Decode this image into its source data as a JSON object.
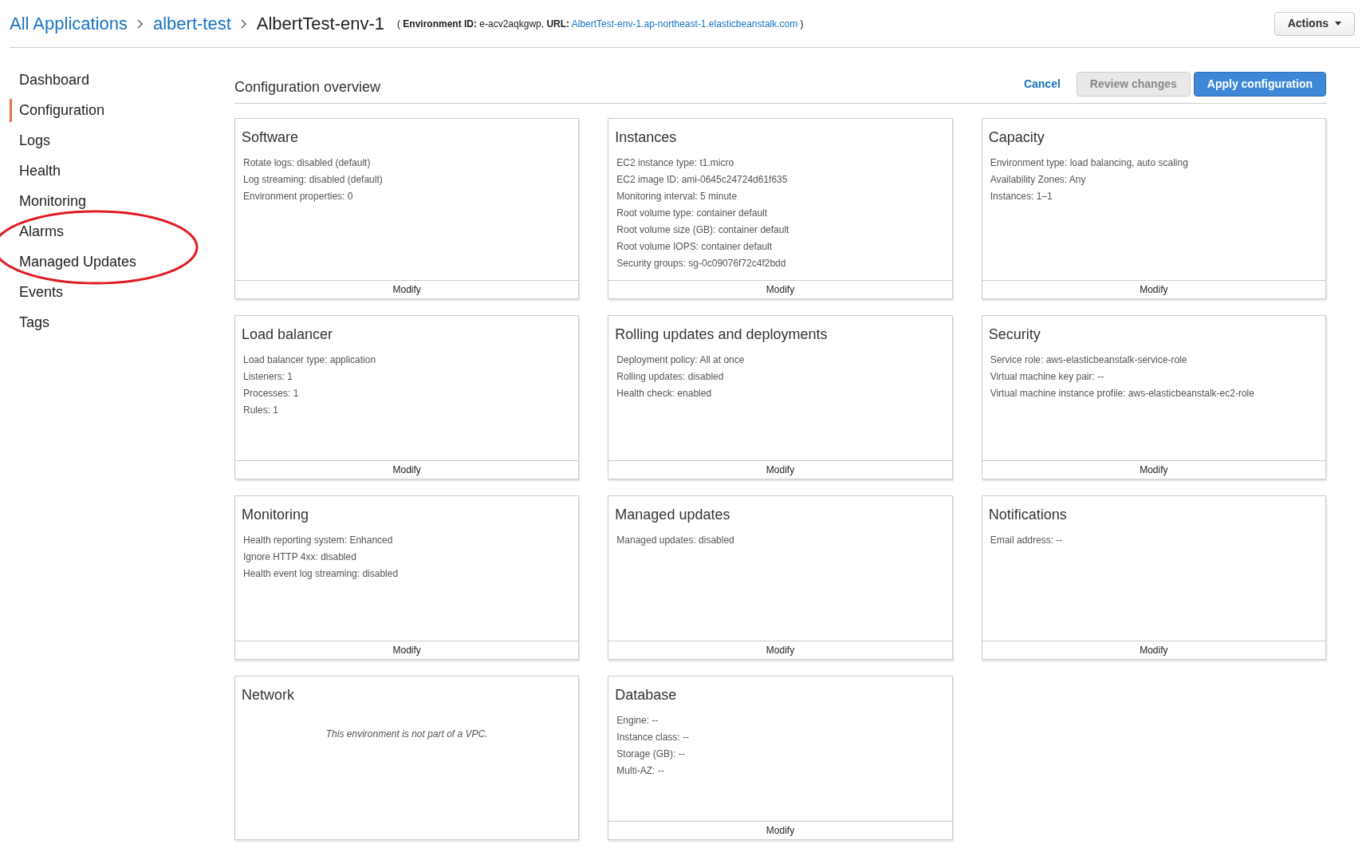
{
  "breadcrumb": [
    {
      "label": "All Applications",
      "kind": "link"
    },
    {
      "label": "albert-test",
      "kind": "link"
    },
    {
      "label": "AlbertTest-env-1",
      "kind": "current"
    }
  ],
  "environment_info": {
    "prefix": "( **Environment ID:** e-acv2aqkgwp, **URL:** ",
    "url": "AlbertTest-env-1.ap-northeast-1.elasticbeanstalk.com",
    "suffix": ")"
  },
  "actions_button": "Actions",
  "sidebar": {
    "items": [
      {
        "label": "Dashboard",
        "selected": false
      },
      {
        "label": "Configuration",
        "selected": true
      },
      {
        "label": "Logs",
        "selected": false
      },
      {
        "label": "Health",
        "selected": false
      },
      {
        "label": "Monitoring",
        "selected": false
      },
      {
        "label": "Alarms",
        "selected": false
      },
      {
        "label": "Managed Updates",
        "selected": false
      },
      {
        "label": "Events",
        "selected": false
      },
      {
        "label": "Tags",
        "selected": false
      }
    ]
  },
  "page_title": "Configuration overview",
  "buttons": [
    {
      "label": "Cancel",
      "kind": "link"
    },
    {
      "label": "Review changes",
      "kind": "disabled"
    },
    {
      "label": "Apply configuration",
      "kind": "primary"
    }
  ],
  "cards": [
    {
      "title": "Software",
      "kind": "list",
      "lines": [
        "Rotate logs: disabled (default)",
        "Log streaming: disabled (default)",
        "Environment properties: 0"
      ],
      "action": "Modify"
    },
    {
      "title": "Instances",
      "kind": "list",
      "lines": [
        "EC2 instance type: t1.micro",
        "EC2 image ID: ami-0645c24724d61f635",
        "Monitoring interval: 5 minute",
        "Root volume type: container default",
        "Root volume size (GB): container default",
        "Root volume IOPS: container default",
        "Security groups: sg-0c09076f72c4f2bdd"
      ],
      "action": "Modify"
    },
    {
      "title": "Capacity",
      "kind": "list",
      "lines": [
        "Environment type: load balancing, auto scaling",
        "Availability Zones: Any",
        "Instances: 1–1"
      ],
      "action": "Modify"
    },
    {
      "title": "Load balancer",
      "kind": "list",
      "lines": [
        "Load balancer type: application",
        "Listeners: 1",
        "Processes: 1",
        "Rules: 1"
      ],
      "action": "Modify"
    },
    {
      "title": "Rolling updates and deployments",
      "kind": "list",
      "lines": [
        "Deployment policy: All at once",
        "Rolling updates: disabled",
        "Health check: enabled"
      ],
      "action": "Modify"
    },
    {
      "title": "Security",
      "kind": "list",
      "lines": [
        "Service role: aws-elasticbeanstalk-service-role",
        "Virtual machine key pair: --",
        "Virtual machine instance profile: aws-elasticbeanstalk-ec2-role"
      ],
      "action": "Modify"
    },
    {
      "title": "Monitoring",
      "kind": "list",
      "lines": [
        "Health reporting system: Enhanced",
        "Ignore HTTP 4xx: disabled",
        "Health event log streaming: disabled"
      ],
      "action": "Modify"
    },
    {
      "title": "Managed updates",
      "kind": "list",
      "lines": [
        "Managed updates: disabled"
      ],
      "action": "Modify"
    },
    {
      "title": "Notifications",
      "kind": "list",
      "lines": [
        "Email address: --"
      ],
      "action": "Modify"
    },
    {
      "title": "Network",
      "kind": "note",
      "lines": [
        "This environment is not part of a VPC."
      ]
    },
    {
      "title": "Database",
      "kind": "list",
      "lines": [
        "Engine: --",
        "Instance class: --",
        "Storage (GB): --",
        "Multi-AZ: --"
      ],
      "action": "Modify"
    }
  ]
}
